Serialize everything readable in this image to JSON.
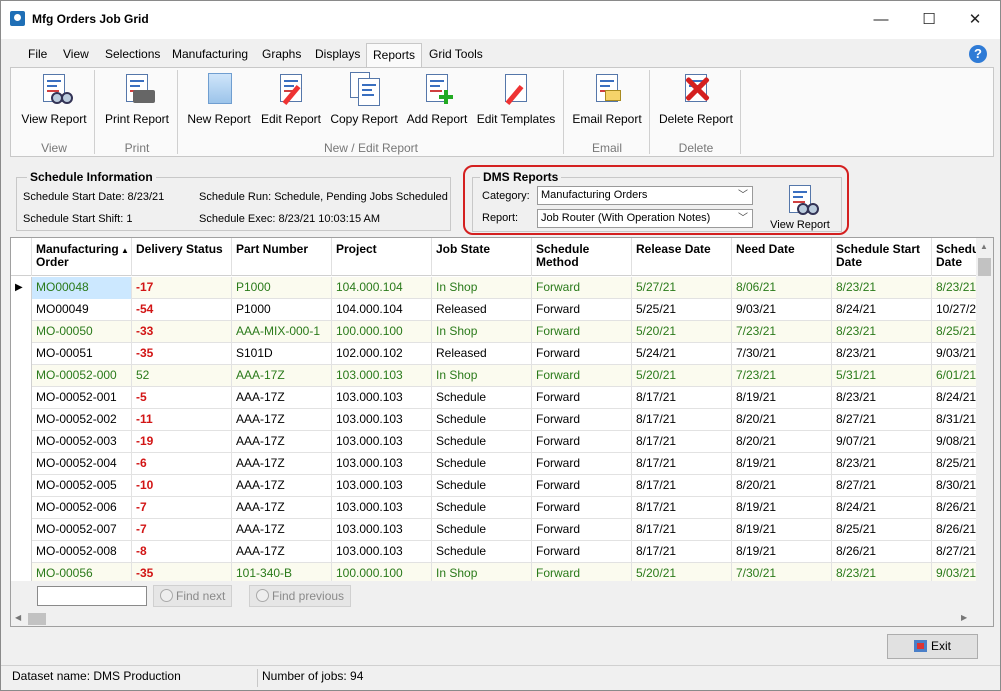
{
  "window": {
    "title": "Mfg Orders Job Grid",
    "minimize": "—",
    "maximize": "☐",
    "close": "✕"
  },
  "menu": [
    "File",
    "View",
    "Selections",
    "Manufacturing",
    "Graphs",
    "Displays",
    "Reports",
    "Grid Tools"
  ],
  "active_menu": "Reports",
  "help": "?",
  "ribbon": {
    "buttons": {
      "view_report": "View Report",
      "print_report": "Print Report",
      "new_report": "New Report",
      "edit_report": "Edit Report",
      "copy_report": "Copy Report",
      "add_report": "Add Report",
      "edit_templates": "Edit Templates",
      "email_report": "Email Report",
      "delete_report": "Delete Report"
    },
    "groups": {
      "view": "View",
      "print": "Print",
      "new_edit": "New / Edit Report",
      "email": "Email",
      "delete": "Delete"
    }
  },
  "schedule_info": {
    "title": "Schedule Information",
    "start_date": "Schedule Start Date: 8/23/21",
    "start_shift": "Schedule Start Shift: 1",
    "run": "Schedule Run:  Schedule, Pending Jobs Scheduled",
    "exec": "Schedule Exec: 8/23/21 10:03:15 AM"
  },
  "dms_reports": {
    "title": "DMS Reports",
    "category_label": "Category:",
    "category_value": "Manufacturing Orders",
    "report_label": "Report:",
    "report_value": "Job Router (With Operation Notes)",
    "view_button": "View Report"
  },
  "grid": {
    "columns": [
      {
        "label": "Manufacturing\nOrder",
        "sort": "▲"
      },
      {
        "label": "Delivery Status"
      },
      {
        "label": "Part Number"
      },
      {
        "label": "Project"
      },
      {
        "label": "Job State"
      },
      {
        "label": "Schedule\nMethod"
      },
      {
        "label": "Release Date"
      },
      {
        "label": "Need Date"
      },
      {
        "label": "Schedule Start\nDate"
      },
      {
        "label": "Schedu\nDate"
      }
    ],
    "rows": [
      {
        "mo": "MO00048",
        "delivery": "-17",
        "part": "P1000",
        "project": "104.000.104",
        "state": "In Shop",
        "method": "Forward",
        "release": "5/27/21",
        "need": "8/06/21",
        "sched_start": "8/23/21",
        "sched_end": "8/23/21",
        "green": true,
        "selected": true
      },
      {
        "mo": "MO00049",
        "delivery": "-54",
        "part": "P1000",
        "project": "104.000.104",
        "state": "Released",
        "method": "Forward",
        "release": "5/25/21",
        "need": "9/03/21",
        "sched_start": "8/24/21",
        "sched_end": "10/27/2",
        "green": false
      },
      {
        "mo": "MO-00050",
        "delivery": "-33",
        "part": "AAA-MIX-000-1",
        "project": "100.000.100",
        "state": "In Shop",
        "method": "Forward",
        "release": "5/20/21",
        "need": "7/23/21",
        "sched_start": "8/23/21",
        "sched_end": "8/25/21",
        "green": true
      },
      {
        "mo": "MO-00051",
        "delivery": "-35",
        "part": "S101D",
        "project": "102.000.102",
        "state": "Released",
        "method": "Forward",
        "release": "5/24/21",
        "need": "7/30/21",
        "sched_start": "8/23/21",
        "sched_end": "9/03/21",
        "green": false
      },
      {
        "mo": "MO-00052-000",
        "delivery": "52",
        "part": "AAA-17Z",
        "project": "103.000.103",
        "state": "In Shop",
        "method": "Forward",
        "release": "5/20/21",
        "need": "7/23/21",
        "sched_start": "5/31/21",
        "sched_end": "6/01/21",
        "green": true,
        "delivery_green": true
      },
      {
        "mo": "MO-00052-001",
        "delivery": "-5",
        "part": "AAA-17Z",
        "project": "103.000.103",
        "state": "Schedule",
        "method": "Forward",
        "release": "8/17/21",
        "need": "8/19/21",
        "sched_start": "8/23/21",
        "sched_end": "8/24/21",
        "green": false
      },
      {
        "mo": "MO-00052-002",
        "delivery": "-11",
        "part": "AAA-17Z",
        "project": "103.000.103",
        "state": "Schedule",
        "method": "Forward",
        "release": "8/17/21",
        "need": "8/20/21",
        "sched_start": "8/27/21",
        "sched_end": "8/31/21",
        "green": false
      },
      {
        "mo": "MO-00052-003",
        "delivery": "-19",
        "part": "AAA-17Z",
        "project": "103.000.103",
        "state": "Schedule",
        "method": "Forward",
        "release": "8/17/21",
        "need": "8/20/21",
        "sched_start": "9/07/21",
        "sched_end": "9/08/21",
        "green": false
      },
      {
        "mo": "MO-00052-004",
        "delivery": "-6",
        "part": "AAA-17Z",
        "project": "103.000.103",
        "state": "Schedule",
        "method": "Forward",
        "release": "8/17/21",
        "need": "8/19/21",
        "sched_start": "8/23/21",
        "sched_end": "8/25/21",
        "green": false
      },
      {
        "mo": "MO-00052-005",
        "delivery": "-10",
        "part": "AAA-17Z",
        "project": "103.000.103",
        "state": "Schedule",
        "method": "Forward",
        "release": "8/17/21",
        "need": "8/20/21",
        "sched_start": "8/27/21",
        "sched_end": "8/30/21",
        "green": false
      },
      {
        "mo": "MO-00052-006",
        "delivery": "-7",
        "part": "AAA-17Z",
        "project": "103.000.103",
        "state": "Schedule",
        "method": "Forward",
        "release": "8/17/21",
        "need": "8/19/21",
        "sched_start": "8/24/21",
        "sched_end": "8/26/21",
        "green": false
      },
      {
        "mo": "MO-00052-007",
        "delivery": "-7",
        "part": "AAA-17Z",
        "project": "103.000.103",
        "state": "Schedule",
        "method": "Forward",
        "release": "8/17/21",
        "need": "8/19/21",
        "sched_start": "8/25/21",
        "sched_end": "8/26/21",
        "green": false
      },
      {
        "mo": "MO-00052-008",
        "delivery": "-8",
        "part": "AAA-17Z",
        "project": "103.000.103",
        "state": "Schedule",
        "method": "Forward",
        "release": "8/17/21",
        "need": "8/19/21",
        "sched_start": "8/26/21",
        "sched_end": "8/27/21",
        "green": false
      },
      {
        "mo": "MO-00056",
        "delivery": "-35",
        "part": "101-340-B",
        "project": "100.000.100",
        "state": "In Shop",
        "method": "Forward",
        "release": "5/20/21",
        "need": "7/30/21",
        "sched_start": "8/23/21",
        "sched_end": "9/03/21",
        "green": true
      }
    ],
    "find_next": "Find next",
    "find_previous": "Find previous"
  },
  "exit_label": "Exit",
  "status": {
    "dataset": "Dataset name:  DMS Production",
    "jobs": "Number of jobs: 94"
  },
  "colors": {
    "green_text": "#2a7a1a",
    "red_text": "#d21515",
    "highlight_outline": "#d42020",
    "row_alt": "#fbfbef"
  }
}
